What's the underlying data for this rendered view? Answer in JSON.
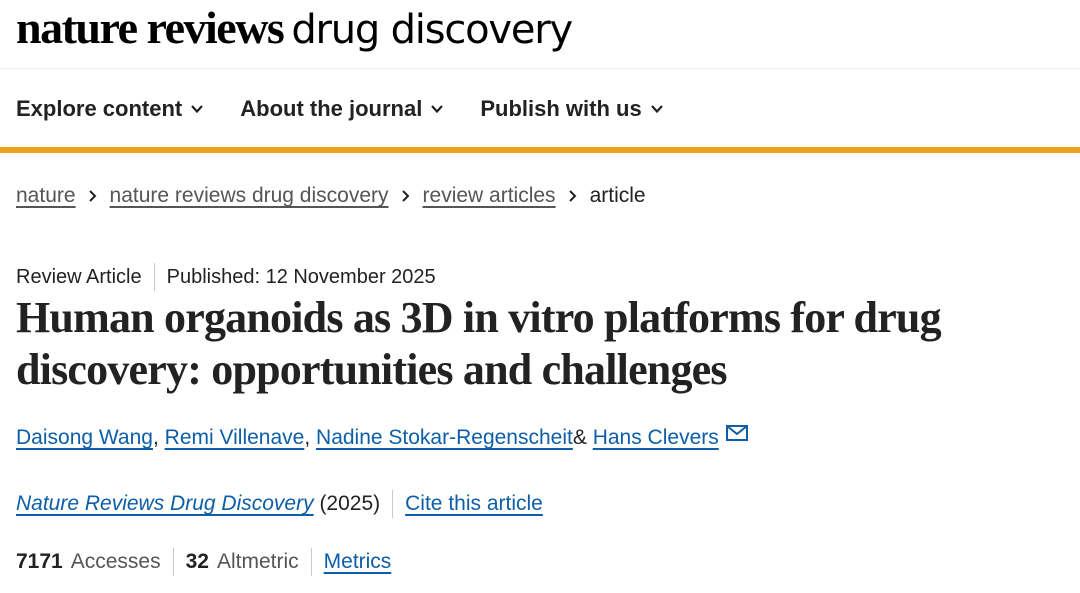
{
  "header": {
    "logo_bold": "nature reviews",
    "logo_light": "drug discovery"
  },
  "nav": {
    "items": [
      {
        "label": "Explore content",
        "icon": "chevron-down-icon"
      },
      {
        "label": "About the journal",
        "icon": "chevron-down-icon"
      },
      {
        "label": "Publish with us",
        "icon": "chevron-down-icon"
      }
    ]
  },
  "colors": {
    "accent_bar": "#e9a21a",
    "link": "#0c5ea8"
  },
  "breadcrumb": {
    "items": [
      "nature",
      "nature reviews drug discovery",
      "review articles"
    ],
    "current": "article"
  },
  "article": {
    "type": "Review Article",
    "published": "Published: 12 November 2025",
    "title": "Human organoids as 3D in vitro platforms for drug discovery: opportunities and challenges",
    "authors": [
      {
        "name": "Daisong Wang",
        "sep": ","
      },
      {
        "name": "Remi Villenave",
        "sep": ","
      },
      {
        "name": "Nadine Stokar-Regenscheit",
        "sep": " &"
      },
      {
        "name": "Hans Clevers",
        "sep": ""
      }
    ],
    "corresponding_icon": "mail-icon",
    "journal": "Nature Reviews Drug Discovery",
    "year": "(2025)",
    "cite_label": "Cite this article"
  },
  "metrics": {
    "accesses_value": "7171",
    "accesses_label": "Accesses",
    "altmetric_value": "32",
    "altmetric_label": "Altmetric",
    "metrics_link": "Metrics"
  }
}
